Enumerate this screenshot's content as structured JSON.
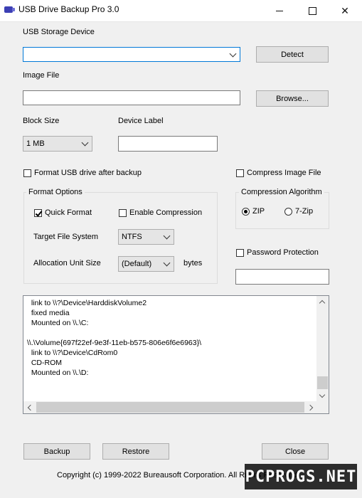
{
  "window": {
    "title": "USB Drive Backup Pro 3.0",
    "controls": {
      "minimize": "minimize",
      "maximize": "maximize",
      "close": "✕"
    }
  },
  "device": {
    "label": "USB Storage Device",
    "selected": "",
    "detect_button": "Detect"
  },
  "image_file": {
    "label": "Image File",
    "value": "",
    "browse_button": "Browse..."
  },
  "block_size": {
    "label": "Block Size",
    "selected": "1 MB"
  },
  "device_label": {
    "label": "Device Label",
    "value": ""
  },
  "format_after_backup": {
    "label": "Format USB drive after backup",
    "checked": false
  },
  "format_options": {
    "title": "Format Options",
    "quick_format": {
      "label": "Quick Format",
      "checked": true
    },
    "enable_compression": {
      "label": "Enable Compression",
      "checked": false
    },
    "target_fs": {
      "label": "Target File System",
      "selected": "NTFS"
    },
    "alloc_unit": {
      "label": "Allocation Unit Size",
      "selected": "(Default)",
      "unit": "bytes"
    }
  },
  "compress_image": {
    "label": "Compress Image File",
    "checked": false
  },
  "compression_algorithm": {
    "title": "Compression Algorithm",
    "options": [
      "ZIP",
      "7-Zip"
    ],
    "selected": "ZIP"
  },
  "password": {
    "label": "Password Protection",
    "checked": false,
    "value": ""
  },
  "log": {
    "text": "  link to \\\\?\\Device\\HarddiskVolume2\n  fixed media\n  Mounted on \\\\.\\C:\n\n\\\\.\\Volume{697f22ef-9e3f-11eb-b575-806e6f6e6963}\\\n  link to \\\\?\\Device\\CdRom0\n  CD-ROM\n  Mounted on \\\\.\\D:"
  },
  "footer": {
    "backup_button": "Backup",
    "restore_button": "Restore",
    "close_button": "Close",
    "copyright": "Copyright (c) 1999-2022 Bureausoft Corporation. All Rights Reserved.",
    "watermark": "PCPROGS.NET"
  }
}
